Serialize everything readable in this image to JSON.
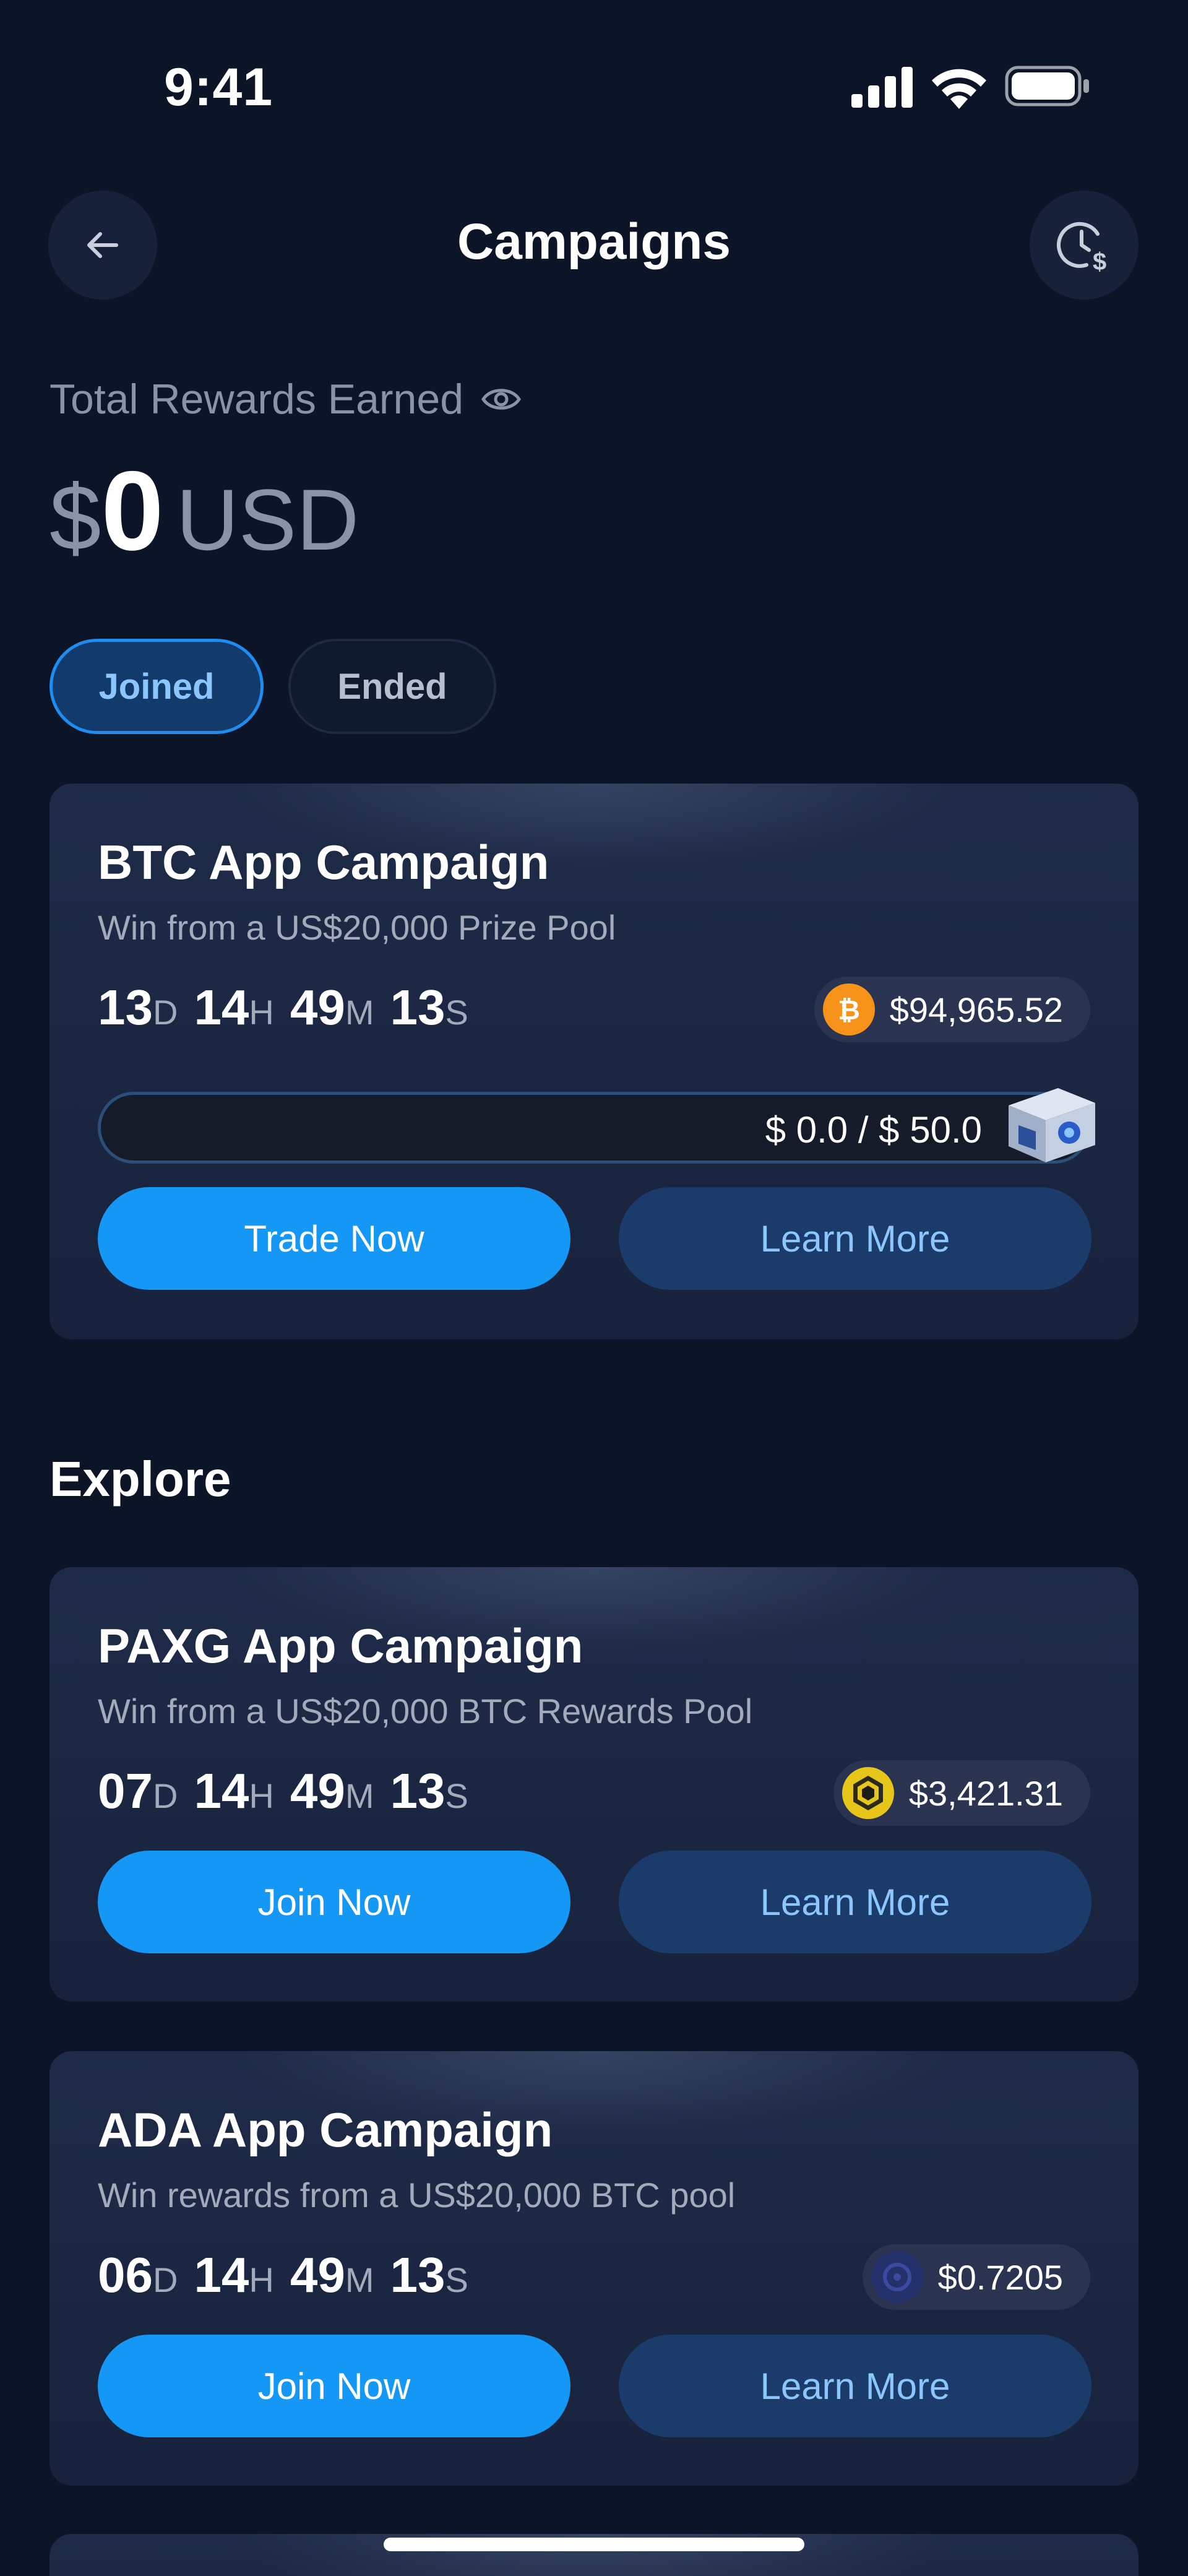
{
  "status_bar": {
    "time": "9:41"
  },
  "header": {
    "title": "Campaigns"
  },
  "rewards": {
    "label": "Total Rewards Earned",
    "currency_symbol": "$",
    "amount": "0",
    "unit": "USD"
  },
  "filters": {
    "joined": "Joined",
    "ended": "Ended",
    "active": "joined"
  },
  "joined_campaign": {
    "title": "BTC App Campaign",
    "subtitle": "Win from a US$20,000 Prize Pool",
    "countdown": {
      "d": "13",
      "h": "14",
      "m": "49",
      "s": "13"
    },
    "price": "$94,965.52",
    "coin": "BTC",
    "progress_text": "$ 0.0 / $ 50.0",
    "progress_fraction": 0,
    "primary_label": "Trade Now",
    "secondary_label": "Learn More"
  },
  "explore": {
    "title": "Explore",
    "campaigns": [
      {
        "title": "PAXG App Campaign",
        "subtitle": "Win from a US$20,000 BTC Rewards Pool",
        "countdown": {
          "d": "07",
          "h": "14",
          "m": "49",
          "s": "13"
        },
        "price": "$3,421.31",
        "coin": "PAXG",
        "primary_label": "Join Now",
        "secondary_label": "Learn More"
      },
      {
        "title": "ADA App Campaign",
        "subtitle": "Win rewards from a US$20,000 BTC pool",
        "countdown": {
          "d": "06",
          "h": "14",
          "m": "49",
          "s": "13"
        },
        "price": "$0.7205",
        "coin": "ADA",
        "primary_label": "Join Now",
        "secondary_label": "Learn More"
      }
    ]
  },
  "units": {
    "d": "D",
    "h": "H",
    "m": "M",
    "s": "S"
  },
  "colors": {
    "background": "#0c1428",
    "accent": "#1598f5",
    "btc": "#f7931a",
    "paxg": "#e6c619"
  }
}
